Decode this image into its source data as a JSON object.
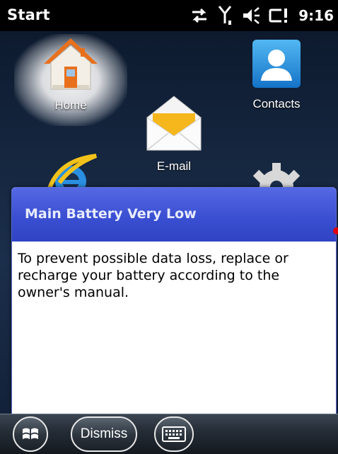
{
  "status": {
    "title": "Start",
    "time": "9:16",
    "icons": [
      "data-sync-icon",
      "signal-icon",
      "volume-muted-icon",
      "battery-critical-icon"
    ]
  },
  "home": {
    "tiles": [
      {
        "label": "Home",
        "icon": "house-icon"
      },
      {
        "label": "Contacts",
        "icon": "contacts-icon"
      },
      {
        "label": "E-mail",
        "icon": "envelope-icon"
      },
      {
        "label": "",
        "icon": "internet-explorer-icon"
      },
      {
        "label": "",
        "icon": "settings-gear-icon"
      }
    ]
  },
  "dialog": {
    "title": "Main Battery Very Low",
    "message": "To prevent possible data loss, replace or recharge your battery according to the owner's manual."
  },
  "softkeys": {
    "start_icon": "windows-start-icon",
    "dismiss_label": "Dismiss",
    "keyboard_icon": "keyboard-icon"
  },
  "colors": {
    "dialog_header": "#3b4fd2",
    "dialog_border": "#5a6cd6",
    "alert_dot": "#e00000"
  }
}
